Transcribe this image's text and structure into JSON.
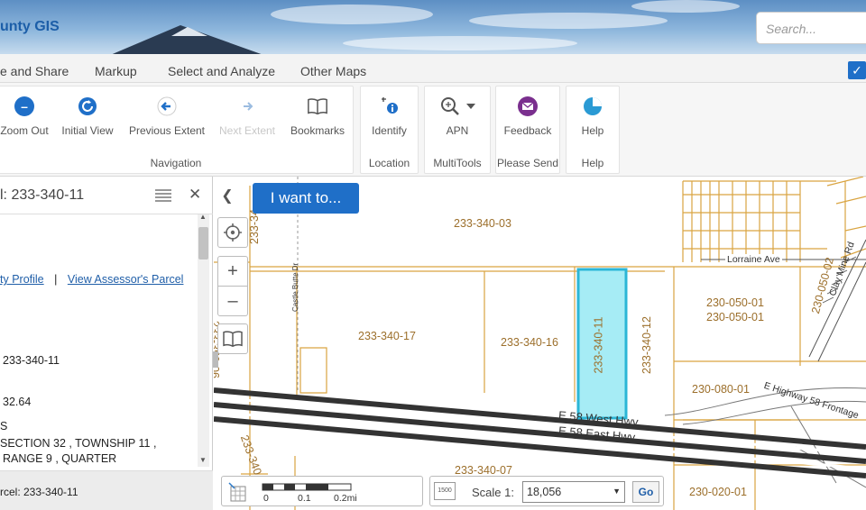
{
  "header": {
    "title": "unty GIS",
    "search_placeholder": "Search..."
  },
  "menu": {
    "items": [
      "e and Share",
      "Markup",
      "Select and Analyze",
      "Other Maps"
    ]
  },
  "toolbar": {
    "groups": [
      {
        "label": "Navigation",
        "tools": [
          "Zoom Out",
          "Initial View",
          "Previous Extent",
          "Next Extent",
          "Bookmarks"
        ]
      },
      {
        "label": "Location",
        "tools": [
          "Identify"
        ]
      },
      {
        "label": "MultiTools",
        "tools": [
          "APN"
        ]
      },
      {
        "label": "Please Send",
        "tools": [
          "Feedback"
        ]
      },
      {
        "label": "Help",
        "tools": [
          "Help"
        ]
      }
    ]
  },
  "panel": {
    "title": "l: 233-340-11",
    "link_profile": "ty Profile",
    "separator": "|",
    "link_assessor": "View Assessor's Parcel",
    "apn_value": "233-340-11",
    "acres_value": "32.64",
    "line_s": "S",
    "legal_line1": "SECTION 32 , TOWNSHIP 11 ,",
    "legal_line2": "RANGE 9  , QUARTER",
    "footer_text": "rcel: 233-340-11"
  },
  "map": {
    "i_want_label": "I want to...",
    "parcels": [
      "233-340-03",
      "233-340-17",
      "233-340-16",
      "233-340-11",
      "233-340-12",
      "230-050-01",
      "230-050-01",
      "230-080-01",
      "233-340-07",
      "230-020-01",
      "233-350-06",
      "233-340",
      "233-34",
      "230-050-02"
    ],
    "roads": [
      "Lorraine Ave",
      "E 58 West Hwy",
      "E 58 East Hwy",
      "E Highway 58 Frontage",
      "Clay Mine Rd",
      "Castle Butte Dr"
    ],
    "scale_bar": {
      "t0": "0",
      "t1": "0.1",
      "t2": "0.2mi"
    },
    "scale_label": "Scale 1:",
    "scale_value": "18,056",
    "go_label": "Go",
    "scale_icon_text": "1500"
  },
  "colors": {
    "accent": "#1f6fc8",
    "parcel_line": "#d9a441",
    "selected_fill": "#a6ecf5",
    "selected_stroke": "#2bb6d6"
  }
}
